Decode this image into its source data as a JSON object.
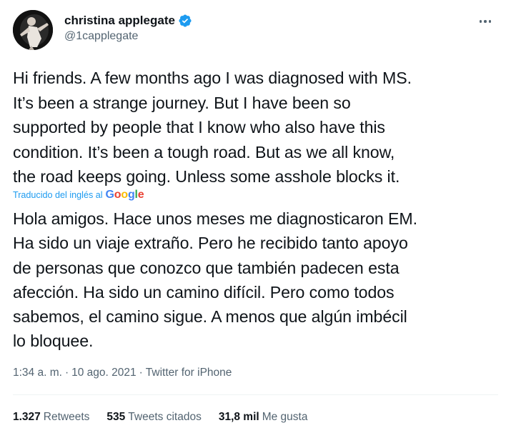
{
  "author": {
    "display_name": "christina applegate",
    "handle": "@1capplegate",
    "verified_icon": "verified-badge-icon",
    "avatar_icon": "avatar"
  },
  "tweet": {
    "text": "Hi friends. A few months ago I was diagnosed with MS.\nIt’s been a strange journey. But I have been so\nsupported by people that I know who also have this\ncondition. It’s been a tough road. But as we all know,\nthe road keeps going. Unless some asshole blocks it.",
    "translated_by_label": "Traducido del inglés al",
    "translator": "Google",
    "translation": "Hola amigos. Hace unos meses me diagnosticaron EM.\nHa sido un viaje extraño. Pero he recibido tanto apoyo\nde personas que conozco que también padecen esta\nafección. Ha sido un camino difícil. Pero como todos\nsabemos, el camino sigue. A menos que algún imbécil\nlo bloquee."
  },
  "meta": {
    "time": "1:34 a. m.",
    "separator": "·",
    "date": "10 ago. 2021",
    "source": "Twitter for iPhone"
  },
  "stats": {
    "retweets_count": "1.327",
    "retweets_label": "Retweets",
    "quotes_count": "535",
    "quotes_label": "Tweets citados",
    "likes_count": "31,8 mil",
    "likes_label": "Me gusta"
  },
  "colors": {
    "link": "#1d9bf0",
    "secondary_text": "#536471",
    "primary_text": "#0f1419"
  }
}
